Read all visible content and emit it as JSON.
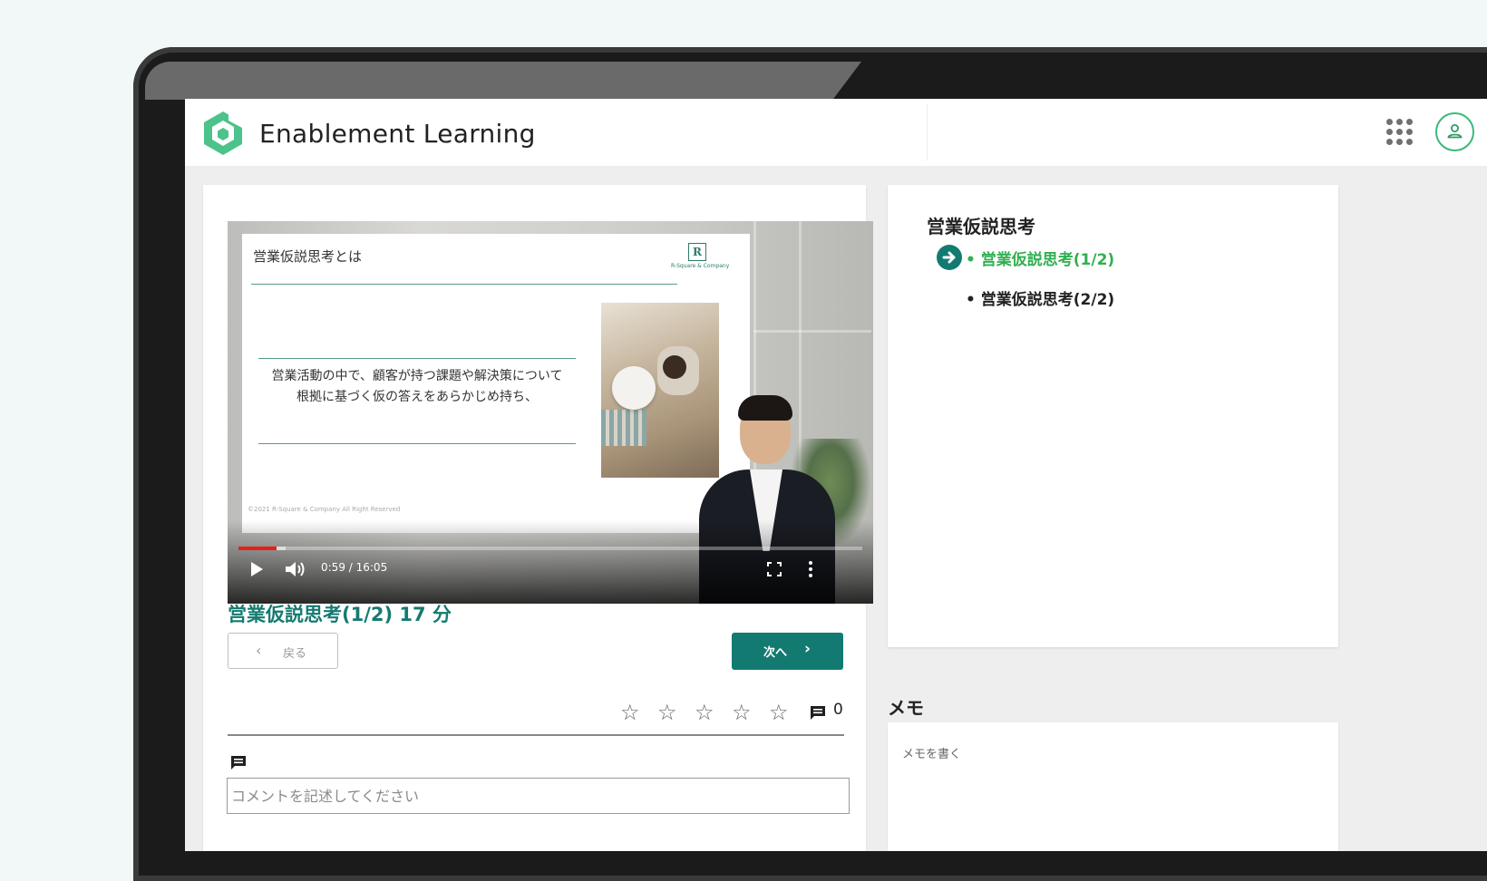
{
  "app": {
    "title": "Enablement Learning",
    "brand_color": "#3cb879",
    "accent_color": "#137a72"
  },
  "header": {
    "apps_icon": "grid-apps-icon",
    "user_icon": "user-account-icon"
  },
  "video": {
    "slide_title": "営業仮説思考とは",
    "slide_body_line1": "営業活動の中で、顧客が持つ課題や解決策について",
    "slide_body_line2": "根拠に基づく仮の答えをあらかじめ持ち、",
    "slide_footer": "©2021 R-Square & Company All Right Reserved",
    "slide_brand_mark": "R",
    "slide_brand": "R-Square & Company",
    "current_time": "0:59",
    "duration": "16:05",
    "time_display": "0:59 / 16:05",
    "progress_fraction": 0.061,
    "buffered_fraction": 0.075
  },
  "lesson": {
    "title": "営業仮説思考(1/2) 17 分",
    "back_label": "戻る",
    "next_label": "次へ",
    "rating_stars": 5,
    "rating_value": 0,
    "comment_count": "0",
    "comment_placeholder": "コメントを記述してください"
  },
  "outline": {
    "title": "営業仮説思考",
    "items": [
      {
        "label": "• 営業仮説思考(1/2)",
        "active": true
      },
      {
        "label": "• 営業仮説思考(2/2)",
        "active": false
      }
    ]
  },
  "memo": {
    "title": "メモ",
    "placeholder": "メモを書く"
  }
}
